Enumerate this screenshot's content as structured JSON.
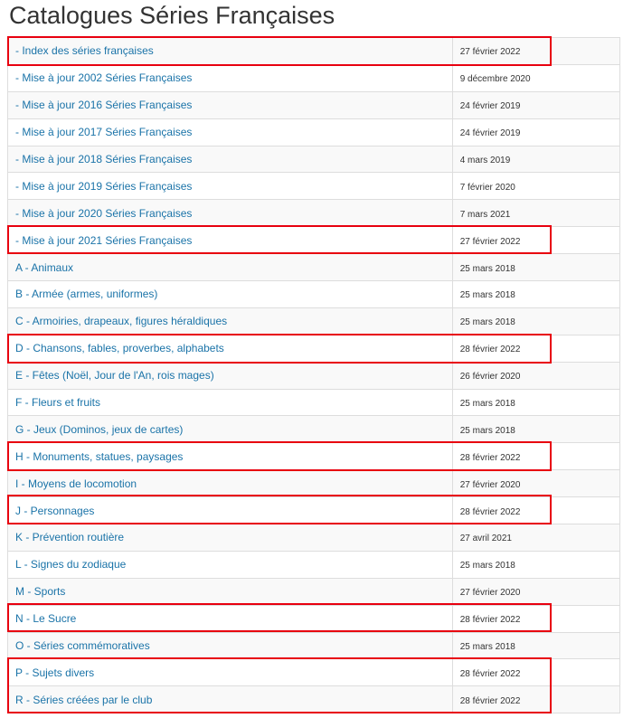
{
  "page": {
    "title": "Catalogues Séries Françaises"
  },
  "rows": [
    {
      "label": "- Index des séries françaises",
      "date": "27 février 2022"
    },
    {
      "label": "- Mise à jour 2002 Séries Françaises",
      "date": "9 décembre 2020"
    },
    {
      "label": "- Mise à jour 2016 Séries Françaises",
      "date": "24 février 2019"
    },
    {
      "label": "- Mise à jour 2017 Séries Françaises",
      "date": "24 février 2019"
    },
    {
      "label": "- Mise à jour 2018 Séries Françaises",
      "date": "4 mars 2019"
    },
    {
      "label": "- Mise à jour 2019 Séries Françaises",
      "date": "7 février 2020"
    },
    {
      "label": "- Mise à jour 2020 Séries Françaises",
      "date": "7 mars 2021"
    },
    {
      "label": "- Mise à jour 2021 Séries Françaises",
      "date": "27 février 2022"
    },
    {
      "label": "A - Animaux",
      "date": "25 mars 2018"
    },
    {
      "label": "B - Armée (armes, uniformes)",
      "date": "25 mars 2018"
    },
    {
      "label": "C - Armoiries, drapeaux, figures héraldiques",
      "date": "25 mars 2018"
    },
    {
      "label": "D - Chansons, fables, proverbes, alphabets",
      "date": "28 février 2022"
    },
    {
      "label": "E - Fêtes (Noël, Jour de l'An, rois mages)",
      "date": "26 février 2020"
    },
    {
      "label": "F - Fleurs et fruits",
      "date": "25 mars 2018"
    },
    {
      "label": "G - Jeux (Dominos, jeux de cartes)",
      "date": "25 mars 2018"
    },
    {
      "label": "H - Monuments, statues, paysages",
      "date": "28 février 2022"
    },
    {
      "label": "I - Moyens de locomotion",
      "date": "27 février 2020"
    },
    {
      "label": "J - Personnages",
      "date": "28 février 2022"
    },
    {
      "label": "K - Prévention routière",
      "date": "27 avril 2021"
    },
    {
      "label": "L - Signes du zodiaque",
      "date": "25 mars 2018"
    },
    {
      "label": "M - Sports",
      "date": "27 février 2020"
    },
    {
      "label": "N - Le Sucre",
      "date": "28 février 2022"
    },
    {
      "label": "O - Séries commémoratives",
      "date": "25 mars 2018"
    },
    {
      "label": "P - Sujets divers",
      "date": "28 février 2022"
    },
    {
      "label": "R - Séries créées par le club",
      "date": "28 février 2022"
    }
  ],
  "colors": {
    "link": "#1a73a8",
    "highlight_border": "#e8000f",
    "row_alt": "#f9f9f9",
    "grid": "#dddddd"
  }
}
